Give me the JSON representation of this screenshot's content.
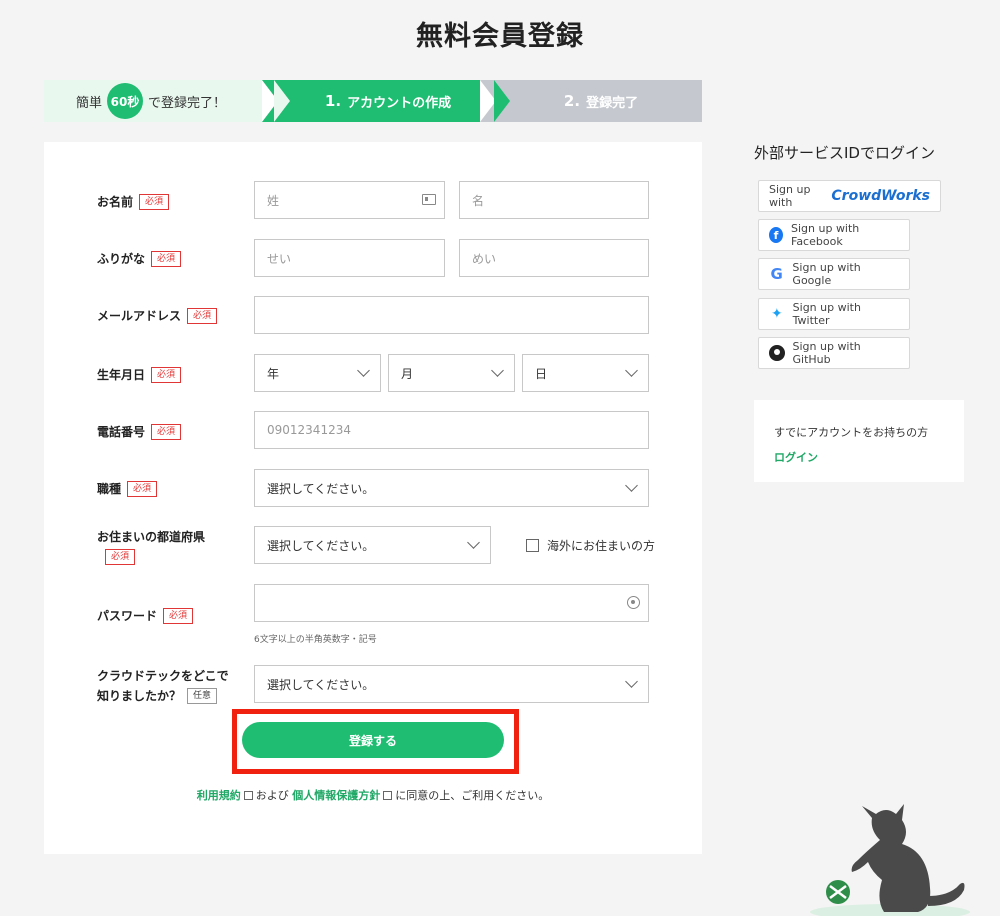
{
  "page": {
    "title": "無料会員登録"
  },
  "stepbar": {
    "intro_prefix": "簡単",
    "intro_badge": "60秒",
    "intro_suffix": "で登録完了！",
    "step1_num": "1.",
    "step1_label": "アカウントの作成",
    "step2_num": "2.",
    "step2_label": "登録完了"
  },
  "form": {
    "required_label": "必須",
    "optional_label": "任意",
    "name": {
      "label": "お名前",
      "last_placeholder": "姓",
      "first_placeholder": "名"
    },
    "kana": {
      "label": "ふりがな",
      "last_placeholder": "せい",
      "first_placeholder": "めい"
    },
    "email": {
      "label": "メールアドレス",
      "value": ""
    },
    "birth": {
      "label": "生年月日",
      "year": "年",
      "month": "月",
      "day": "日"
    },
    "phone": {
      "label": "電話番号",
      "placeholder": "09012341234"
    },
    "job": {
      "label": "職種",
      "value": "選択してください。"
    },
    "prefecture": {
      "label": "お住まいの都道府県",
      "value": "選択してください。",
      "overseas_label": "海外にお住まいの方"
    },
    "password": {
      "label": "パスワード",
      "hint": "6文字以上の半角英数字・記号"
    },
    "referral": {
      "label_line1": "クラウドテックをどこで",
      "label_line2": "知りましたか？",
      "value": "選択してください。"
    },
    "submit_label": "登録する",
    "terms": {
      "link1": "利用規約",
      "middle": "および",
      "link2": "個人情報保護方針",
      "suffix": "に同意の上、ご利用ください。"
    }
  },
  "external": {
    "title": "外部サービスIDでログイン",
    "crowdworks_prefix": "Sign up with",
    "crowdworks_brand": "CrowdWorks",
    "facebook": "Sign up with Facebook",
    "google": "Sign up with Google",
    "twitter": "Sign up with Twitter",
    "github": "Sign up with GitHub"
  },
  "login_card": {
    "text": "すでにアカウントをお持ちの方",
    "link": "ログイン"
  },
  "colors": {
    "accent": "#1fbd72",
    "required": "#e03636",
    "highlight": "#f0210e"
  }
}
